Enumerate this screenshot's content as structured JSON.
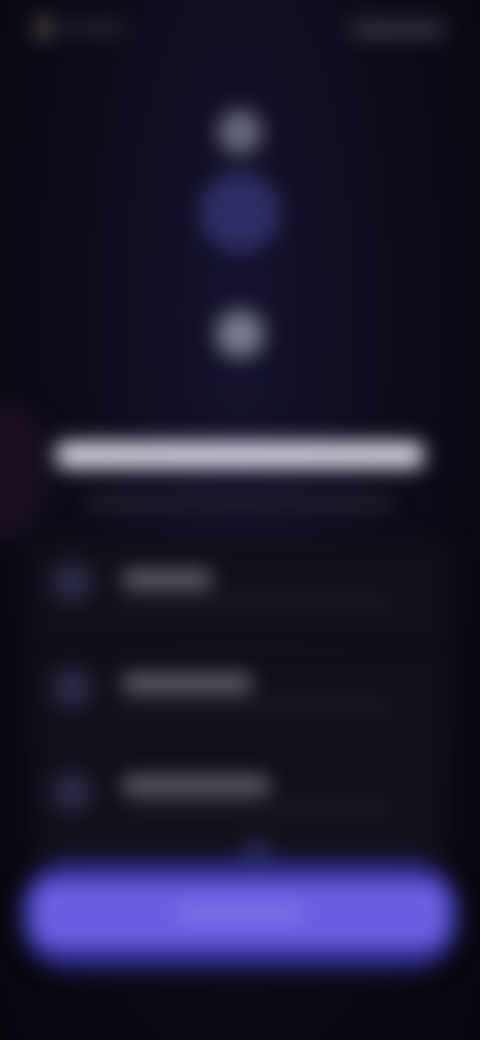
{
  "header": {
    "logo_icon": "app-logo-icon",
    "action_icon": "header-action"
  },
  "hero": {
    "icons": [
      "hero-top-icon",
      "hero-center-icon",
      "hero-bottom-icon"
    ]
  },
  "features": {
    "items": [
      {
        "icon": "feature-icon"
      },
      {
        "icon": "feature-icon"
      },
      {
        "icon": "feature-icon"
      }
    ]
  },
  "cta": {
    "accent": "#6a5fe0"
  }
}
